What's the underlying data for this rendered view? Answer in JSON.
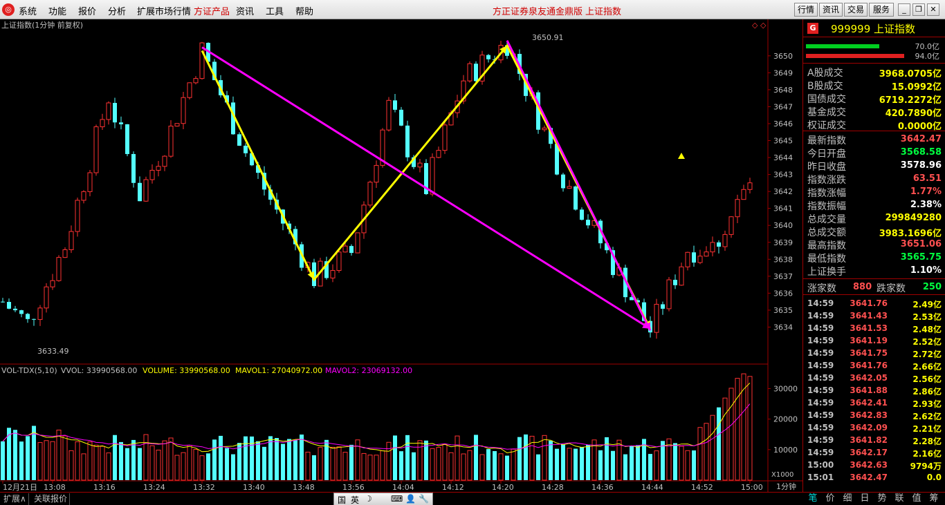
{
  "menu": {
    "items": [
      "系统",
      "功能",
      "报价",
      "分析",
      "扩展市场行情",
      "方证产品",
      "资讯",
      "工具",
      "帮助"
    ],
    "brand1": "方正证券泉友通金鼎版",
    "brand2": "上证指数",
    "buttons": [
      "行情",
      "资讯",
      "交易",
      "服务"
    ]
  },
  "chart": {
    "title": "上证指数(1分钟 前复权)",
    "high_label": "3650.91",
    "low_label": "3633.49",
    "price_ticks": [
      "3650",
      "3649",
      "3648",
      "3647",
      "3646",
      "3645",
      "3644",
      "3643",
      "3642",
      "3641",
      "3640",
      "3639",
      "3638",
      "3637",
      "3636",
      "3635",
      "3634"
    ],
    "vol_ticks": [
      "30000",
      "20000",
      "10000"
    ],
    "vol_unit": "X1000",
    "vol_header": {
      "name": "VOL-TDX(5,10)",
      "vvol": "VVOL: 33990568.00",
      "volume": "VOLUME: 33990568.00",
      "mavol1": "MAVOL1: 27040972.00",
      "mavol2": "MAVOL2: 23069132.00"
    },
    "time_labels": [
      "12月21日",
      "13:08",
      "13:16",
      "13:24",
      "13:32",
      "13:40",
      "13:48",
      "13:56",
      "14:04",
      "14:12",
      "14:20",
      "14:28",
      "14:36",
      "14:44",
      "14:52",
      "15:00"
    ],
    "period_label": "1分钟",
    "colors": {
      "up": "#ff3232",
      "down": "#54ffff",
      "yellow": "#ffff00",
      "magenta": "#ff00ff",
      "grid": "#a00000"
    }
  },
  "chart_data": {
    "type": "candlestick",
    "title": "上证指数(1分钟 前复权)",
    "period": "1分钟",
    "ylim": [
      3633.0,
      3651.5
    ],
    "x_start": "13:00",
    "x_end": "15:00",
    "open": 3568.58,
    "high": 3651.06,
    "low": 3565.75,
    "last": 3642.47,
    "trend_lines": [
      {
        "color": "yellow",
        "points": [
          [
            "13:32",
            3650.3
          ],
          [
            "13:50",
            3636.8
          ],
          [
            "14:21",
            3650.6
          ],
          [
            "14:44",
            3633.9
          ]
        ]
      },
      {
        "color": "magenta",
        "points": [
          [
            "13:32",
            3650.5
          ],
          [
            "14:44",
            3633.9
          ]
        ]
      },
      {
        "color": "magenta",
        "points": [
          [
            "14:21",
            3650.9
          ],
          [
            "14:44",
            3633.8
          ]
        ]
      }
    ],
    "volume": {
      "last": 33990568,
      "mavol1": 27040972,
      "mavol2": 23069132,
      "unit": "X1000"
    }
  },
  "panel": {
    "g_label": "G",
    "code_name": "999999 上证指数",
    "bar1_val": "70.0亿",
    "bar2_val": "94.0亿",
    "stats1": [
      {
        "label": "A股成交",
        "value": "3968.0705亿",
        "color": "#ffff00"
      },
      {
        "label": "B股成交",
        "value": "15.0992亿",
        "color": "#ffff00"
      },
      {
        "label": "国债成交",
        "value": "6719.2272亿",
        "color": "#ffff00"
      },
      {
        "label": "基金成交",
        "value": "420.7890亿",
        "color": "#ffff00"
      },
      {
        "label": "权证成交",
        "value": "0.0000亿",
        "color": "#ffff00"
      }
    ],
    "stats2": [
      {
        "label": "最新指数",
        "value": "3642.47",
        "color": "#ff5050"
      },
      {
        "label": "今日开盘",
        "value": "3568.58",
        "color": "#00ff40"
      },
      {
        "label": "昨日收盘",
        "value": "3578.96",
        "color": "#ffffff"
      },
      {
        "label": "指数涨跌",
        "value": "63.51",
        "color": "#ff5050"
      },
      {
        "label": "指数涨幅",
        "value": "1.77%",
        "color": "#ff5050"
      },
      {
        "label": "指数振幅",
        "value": "2.38%",
        "color": "#ffffff"
      },
      {
        "label": "总成交量",
        "value": "299849280",
        "color": "#ffff00"
      },
      {
        "label": "总成交额",
        "value": "3983.1696亿",
        "color": "#ffff00"
      },
      {
        "label": "最高指数",
        "value": "3651.06",
        "color": "#ff5050"
      },
      {
        "label": "最低指数",
        "value": "3565.75",
        "color": "#00ff40"
      },
      {
        "label": "上证换手",
        "value": "1.10%",
        "color": "#ffffff"
      }
    ],
    "updown": {
      "up_label": "涨家数",
      "up": "880",
      "down_label": "跌家数",
      "down": "250"
    },
    "ticks": [
      {
        "t": "14:59",
        "p": "3641.76",
        "v": "2.49亿"
      },
      {
        "t": "14:59",
        "p": "3641.43",
        "v": "2.53亿"
      },
      {
        "t": "14:59",
        "p": "3641.53",
        "v": "2.48亿"
      },
      {
        "t": "14:59",
        "p": "3641.19",
        "v": "2.52亿"
      },
      {
        "t": "14:59",
        "p": "3641.75",
        "v": "2.72亿"
      },
      {
        "t": "14:59",
        "p": "3641.76",
        "v": "2.66亿"
      },
      {
        "t": "14:59",
        "p": "3642.05",
        "v": "2.56亿"
      },
      {
        "t": "14:59",
        "p": "3641.88",
        "v": "2.86亿"
      },
      {
        "t": "14:59",
        "p": "3642.41",
        "v": "2.93亿"
      },
      {
        "t": "14:59",
        "p": "3642.83",
        "v": "2.62亿"
      },
      {
        "t": "14:59",
        "p": "3642.09",
        "v": "2.21亿"
      },
      {
        "t": "14:59",
        "p": "3641.82",
        "v": "2.28亿"
      },
      {
        "t": "14:59",
        "p": "3642.17",
        "v": "2.16亿"
      },
      {
        "t": "15:00",
        "p": "3642.63",
        "v": "9794万"
      },
      {
        "t": "15:01",
        "p": "3642.47",
        "v": "0.0"
      }
    ],
    "tabs": [
      "笔",
      "价",
      "细",
      "日",
      "势",
      "联",
      "值",
      "筹"
    ]
  },
  "bottom": {
    "tabs": [
      "扩展∧",
      "关联报价"
    ],
    "ime": [
      "国",
      "英",
      "☽",
      "⌨",
      "👤",
      "🔧"
    ]
  }
}
